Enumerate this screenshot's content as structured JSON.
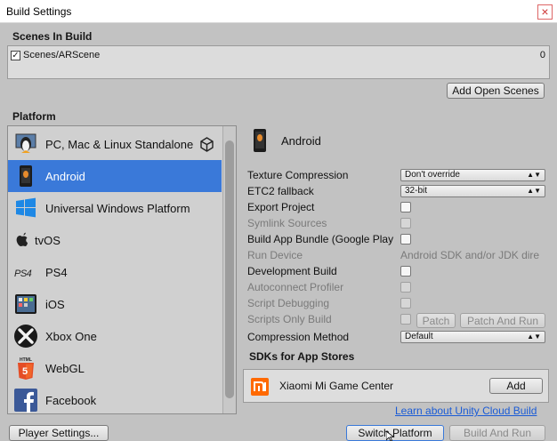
{
  "window": {
    "title": "Build Settings"
  },
  "scenes": {
    "heading": "Scenes In Build",
    "items": [
      {
        "name": "Scenes/ARScene",
        "index": "0",
        "checked": true
      }
    ],
    "add_open_scenes_label": "Add Open Scenes"
  },
  "platform": {
    "heading": "Platform",
    "items": [
      {
        "label": "PC, Mac & Linux Standalone",
        "icon": "pc-mac-linux-icon"
      },
      {
        "label": "Android",
        "icon": "android-icon",
        "selected": true
      },
      {
        "label": "Universal Windows Platform",
        "icon": "windows-icon"
      },
      {
        "label": "tvOS",
        "icon": "appletv-icon"
      },
      {
        "label": "PS4",
        "icon": "ps4-icon"
      },
      {
        "label": "iOS",
        "icon": "ios-icon"
      },
      {
        "label": "Xbox One",
        "icon": "xbox-icon"
      },
      {
        "label": "WebGL",
        "icon": "html5-icon"
      },
      {
        "label": "Facebook",
        "icon": "facebook-icon"
      }
    ]
  },
  "settings": {
    "platform_title": "Android",
    "texture_compression": {
      "label": "Texture Compression",
      "value": "Don't override"
    },
    "etc2_fallback": {
      "label": "ETC2 fallback",
      "value": "32-bit"
    },
    "export_project": {
      "label": "Export Project"
    },
    "symlink_sources": {
      "label": "Symlink Sources"
    },
    "build_app_bundle": {
      "label": "Build App Bundle (Google Play"
    },
    "run_device": {
      "label": "Run Device",
      "value": "Android SDK and/or JDK dire"
    },
    "development_build": {
      "label": "Development Build"
    },
    "autoconnect_profiler": {
      "label": "Autoconnect Profiler"
    },
    "script_debugging": {
      "label": "Script Debugging"
    },
    "scripts_only_build": {
      "label": "Scripts Only Build",
      "patch_label": "Patch",
      "patch_and_run_label": "Patch And Run"
    },
    "compression_method": {
      "label": "Compression Method",
      "value": "Default"
    }
  },
  "sdks": {
    "heading": "SDKs for App Stores",
    "items": [
      {
        "name": "Xiaomi Mi Game Center",
        "add_label": "Add"
      }
    ],
    "learn_link": "Learn about Unity Cloud Build"
  },
  "footer": {
    "player_settings_label": "Player Settings...",
    "switch_platform_label": "Switch Platform",
    "build_and_run_label": "Build And Run"
  },
  "colors": {
    "selection": "#3a79d9",
    "panel": "#c2c2c2",
    "link": "#1a5bd6",
    "xiaomi": "#ff6900"
  }
}
